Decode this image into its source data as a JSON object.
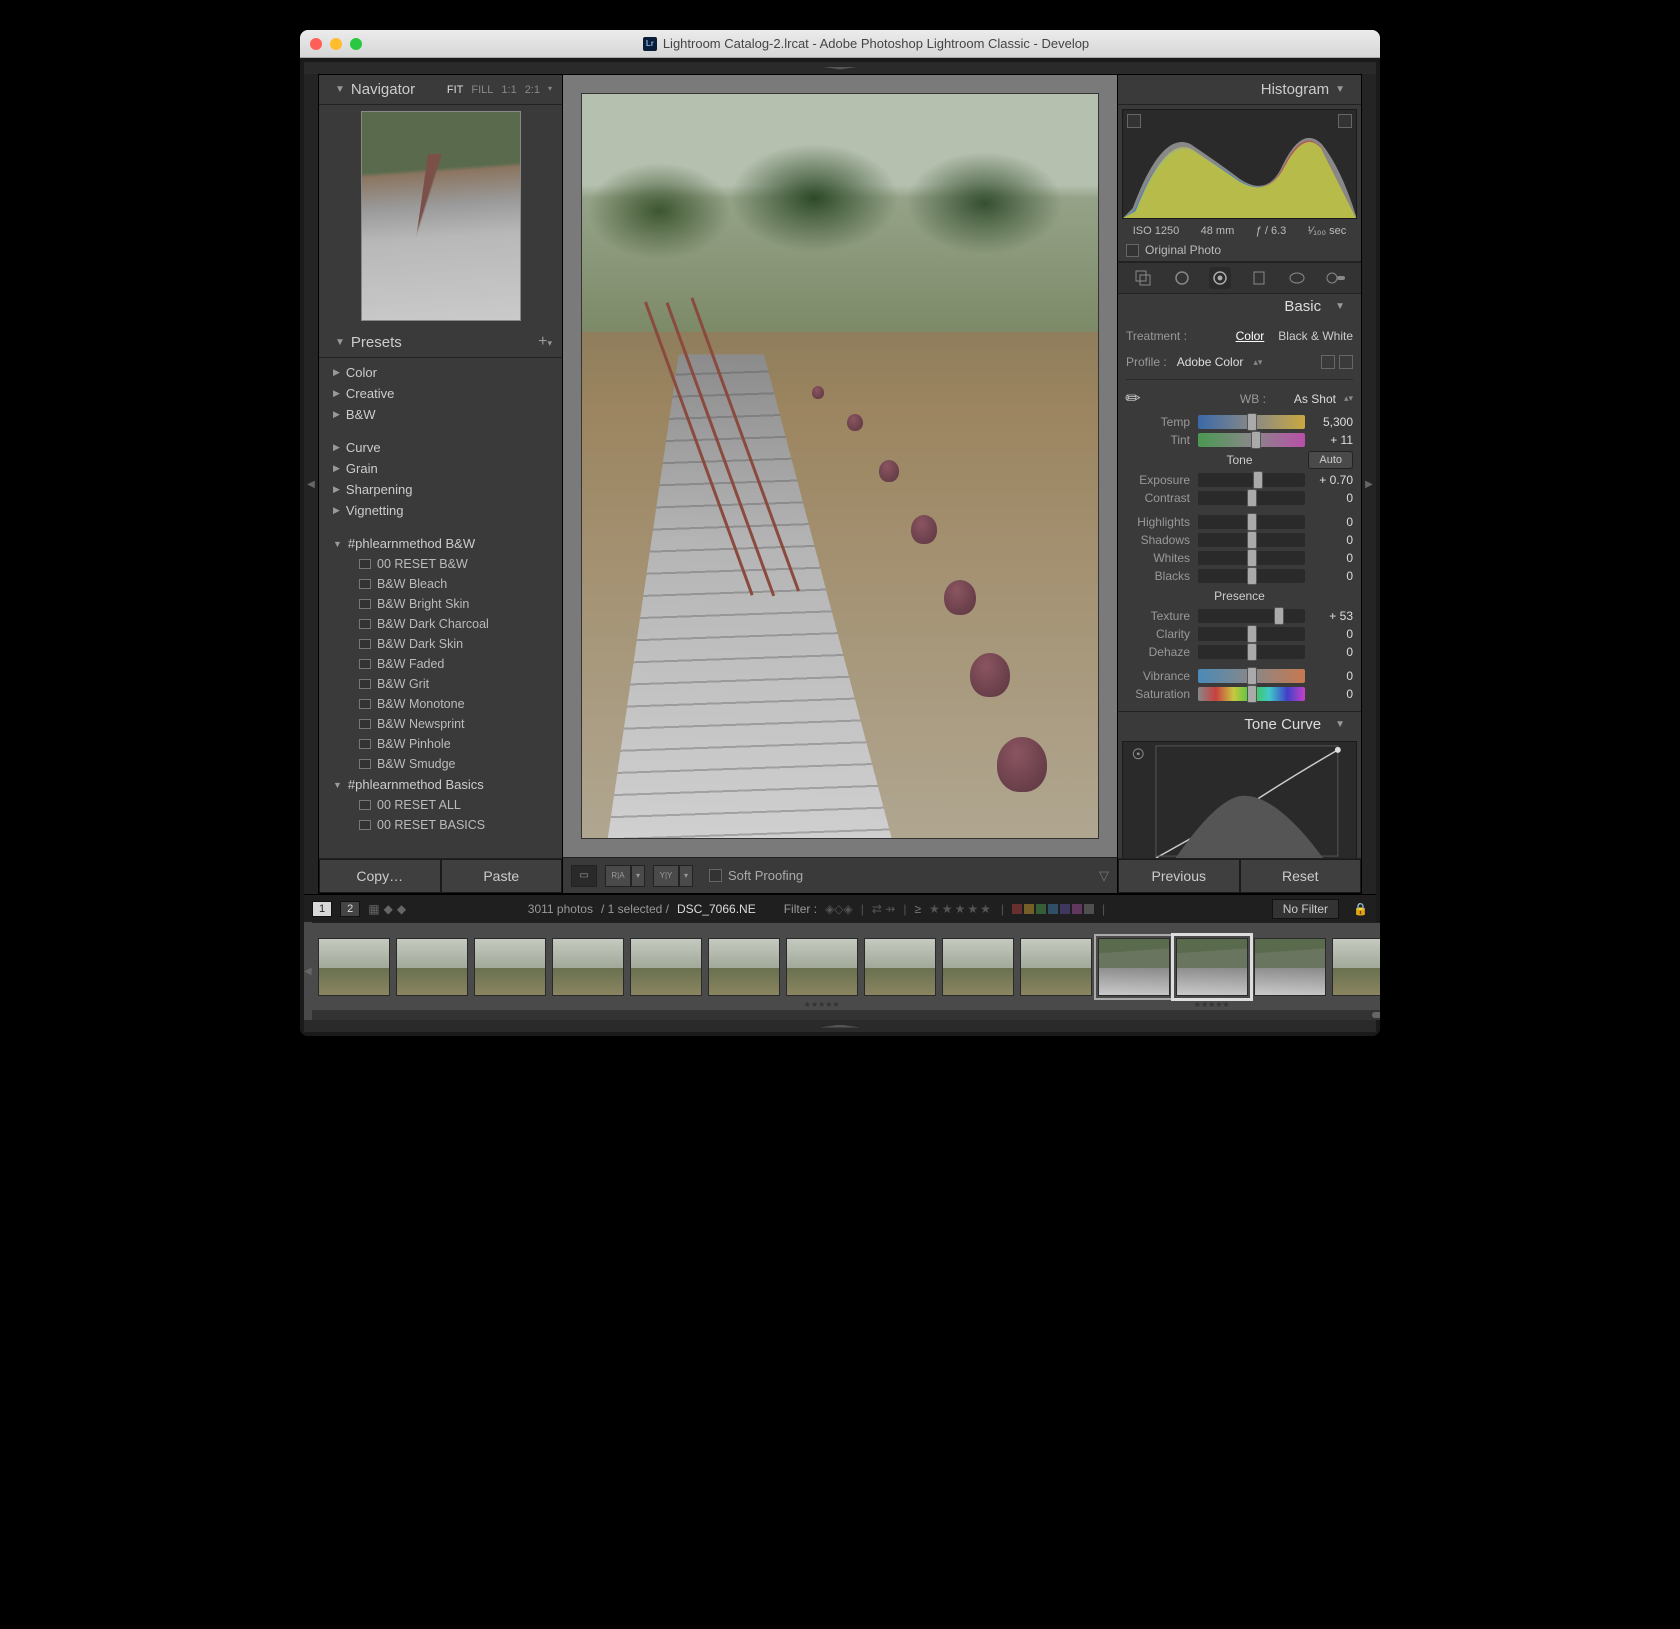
{
  "window": {
    "title": "Lightroom Catalog-2.lrcat - Adobe Photoshop Lightroom Classic - Develop",
    "app_badge": "Lr"
  },
  "navigator": {
    "title": "Navigator",
    "zoom": [
      "FIT",
      "FILL",
      "1:1",
      "2:1"
    ],
    "zoom_active": "FIT"
  },
  "presets": {
    "title": "Presets",
    "groups_top": [
      "Color",
      "Creative",
      "B&W"
    ],
    "groups_mid": [
      "Curve",
      "Grain",
      "Sharpening",
      "Vignetting"
    ],
    "method_bw": {
      "name": "#phlearnmethod B&W",
      "items": [
        "00 RESET B&W",
        "B&W Bleach",
        "B&W Bright Skin",
        "B&W Dark Charcoal",
        "B&W Dark Skin",
        "B&W Faded",
        "B&W Grit",
        "B&W Monotone",
        "B&W Newsprint",
        "B&W Pinhole",
        "B&W Smudge"
      ]
    },
    "method_basics": {
      "name": "#phlearnmethod Basics",
      "items": [
        "00 RESET ALL",
        "00 RESET BASICS"
      ]
    }
  },
  "buttons": {
    "copy": "Copy…",
    "paste": "Paste",
    "previous": "Previous",
    "reset": "Reset",
    "soft_proof": "Soft Proofing"
  },
  "histogram": {
    "title": "Histogram",
    "iso": "ISO 1250",
    "focal": "48 mm",
    "aperture": "ƒ / 6.3",
    "shutter": "¹⁄₁₀₀ sec",
    "original": "Original Photo"
  },
  "basic": {
    "title": "Basic",
    "treatment_label": "Treatment :",
    "treatment": [
      "Color",
      "Black & White"
    ],
    "profile_label": "Profile :",
    "profile": "Adobe Color",
    "wb_label": "WB :",
    "wb": "As Shot",
    "temp": {
      "label": "Temp",
      "value": "5,300",
      "pos": 50
    },
    "tint": {
      "label": "Tint",
      "value": "+ 11",
      "pos": 54
    },
    "tone_hdr": "Tone",
    "auto": "Auto",
    "exposure": {
      "label": "Exposure",
      "value": "+ 0.70",
      "pos": 56
    },
    "contrast": {
      "label": "Contrast",
      "value": "0",
      "pos": 50
    },
    "highlights": {
      "label": "Highlights",
      "value": "0",
      "pos": 50
    },
    "shadows": {
      "label": "Shadows",
      "value": "0",
      "pos": 50
    },
    "whites": {
      "label": "Whites",
      "value": "0",
      "pos": 50
    },
    "blacks": {
      "label": "Blacks",
      "value": "0",
      "pos": 50
    },
    "presence_hdr": "Presence",
    "texture": {
      "label": "Texture",
      "value": "+ 53",
      "pos": 76
    },
    "clarity": {
      "label": "Clarity",
      "value": "0",
      "pos": 50
    },
    "dehaze": {
      "label": "Dehaze",
      "value": "0",
      "pos": 50
    },
    "vibrance": {
      "label": "Vibrance",
      "value": "0",
      "pos": 50
    },
    "saturation": {
      "label": "Saturation",
      "value": "0",
      "pos": 50
    }
  },
  "tonecurve": {
    "title": "Tone Curve"
  },
  "filterbar": {
    "count": "3011 photos",
    "selected": "/ 1 selected /",
    "file": "DSC_7066.NE",
    "filter_label": "Filter :",
    "nofilter": "No Filter",
    "view1": "1",
    "view2": "2"
  },
  "filmstrip": {
    "thumbs": [
      {
        "stairs": false
      },
      {
        "stairs": false
      },
      {
        "stairs": false
      },
      {
        "stairs": false
      },
      {
        "stairs": false
      },
      {
        "stairs": false
      },
      {
        "stairs": false,
        "stars": "★★★★★"
      },
      {
        "stairs": false
      },
      {
        "stairs": false
      },
      {
        "stairs": false
      },
      {
        "stairs": true,
        "near": true
      },
      {
        "stairs": true,
        "sel": true,
        "stars": "★★★★★"
      },
      {
        "stairs": true
      },
      {
        "stairs": false
      }
    ]
  },
  "colorchips": [
    "#b04040",
    "#c8a030",
    "#50a050",
    "#4080b0",
    "#6050a0",
    "#a050a0",
    "#808080"
  ]
}
